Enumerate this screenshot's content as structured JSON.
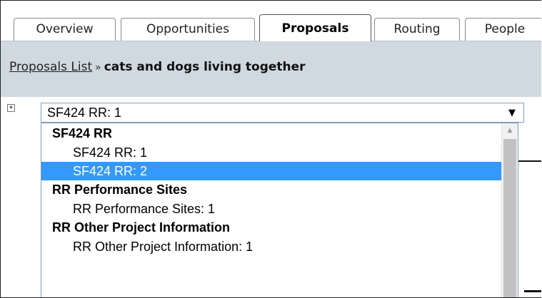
{
  "tabs": [
    {
      "label": "Overview"
    },
    {
      "label": "Opportunities"
    },
    {
      "label": "Proposals"
    },
    {
      "label": "Routing"
    },
    {
      "label": "People"
    }
  ],
  "breadcrumb": {
    "link": "Proposals List",
    "separator": "»",
    "current": "cats and dogs living together"
  },
  "expander": {
    "symbol": "+"
  },
  "form_select": {
    "value": "SF424 RR: 1",
    "arrow": "▼",
    "options": [
      {
        "label": "SF424 RR",
        "kind": "group"
      },
      {
        "label": "SF424 RR: 1",
        "kind": "item"
      },
      {
        "label": "SF424 RR: 2",
        "kind": "item",
        "highlighted": true
      },
      {
        "label": "RR Performance Sites",
        "kind": "group"
      },
      {
        "label": "RR Performance Sites: 1",
        "kind": "item"
      },
      {
        "label": "RR Other Project Information",
        "kind": "group"
      },
      {
        "label": "RR Other Project Information: 1",
        "kind": "item"
      }
    ]
  },
  "scrollbar": {
    "up_arrow": "▲"
  },
  "colors": {
    "highlight": "#3399ff",
    "crumb_bar": "#d0d9e0"
  }
}
